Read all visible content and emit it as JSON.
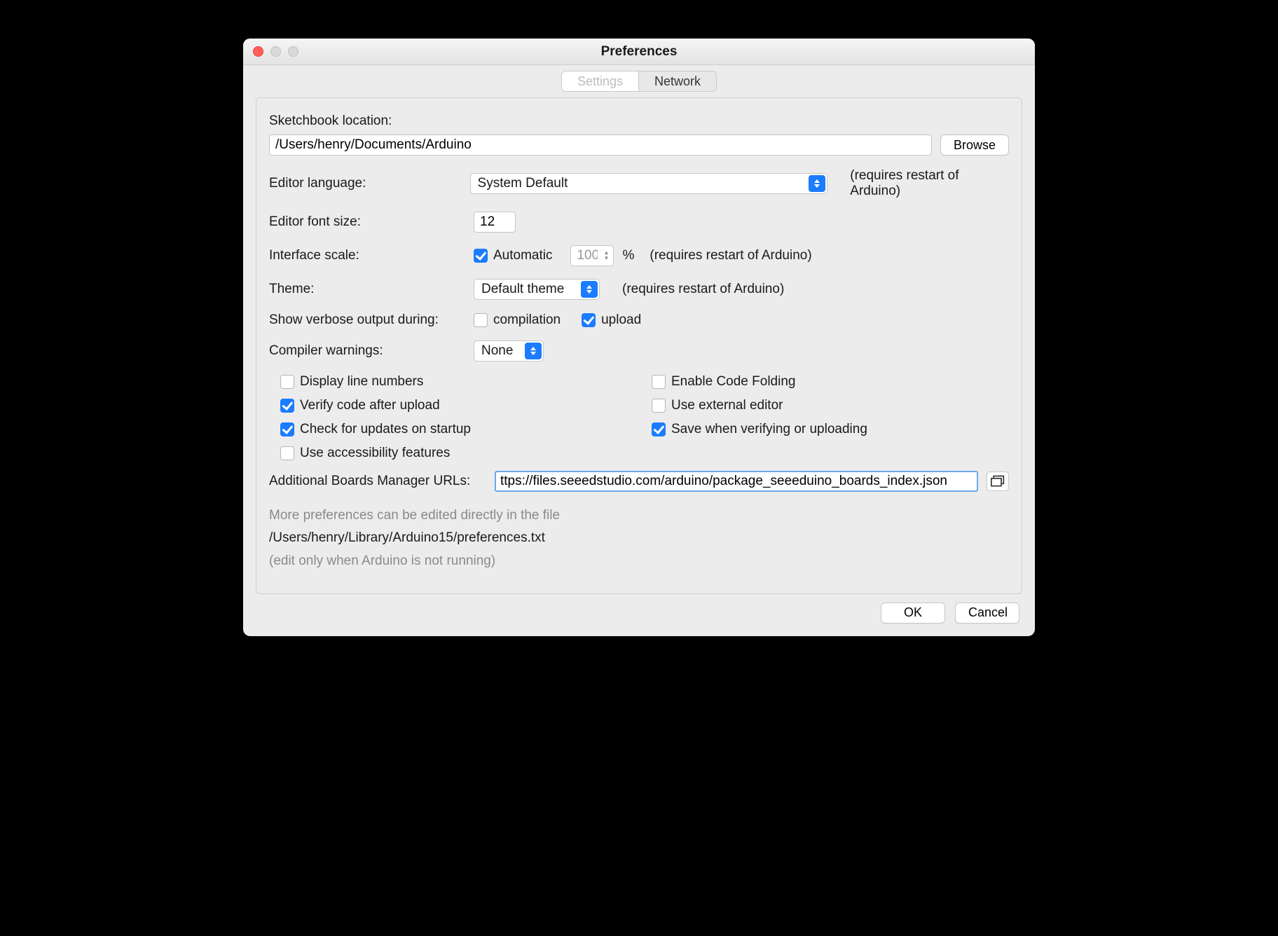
{
  "window": {
    "title": "Preferences"
  },
  "tabs": {
    "settings": "Settings",
    "network": "Network"
  },
  "sketchbook": {
    "label": "Sketchbook location:",
    "value": "/Users/henry/Documents/Arduino",
    "browse": "Browse"
  },
  "editorLanguage": {
    "label": "Editor language:",
    "value": "System Default",
    "hint": "(requires restart of Arduino)"
  },
  "fontSize": {
    "label": "Editor font size:",
    "value": "12"
  },
  "scale": {
    "label": "Interface scale:",
    "autoLabel": "Automatic",
    "autoChecked": true,
    "value": "100",
    "percent": "%",
    "hint": "(requires restart of Arduino)"
  },
  "theme": {
    "label": "Theme:",
    "value": "Default theme",
    "hint": "(requires restart of Arduino)"
  },
  "verbose": {
    "label": "Show verbose output during:",
    "compilationLabel": "compilation",
    "compilationChecked": false,
    "uploadLabel": "upload",
    "uploadChecked": true
  },
  "warnings": {
    "label": "Compiler warnings:",
    "value": "None"
  },
  "options": {
    "lineNumbers": {
      "label": "Display line numbers",
      "checked": false
    },
    "codeFolding": {
      "label": "Enable Code Folding",
      "checked": false
    },
    "verifyUpload": {
      "label": "Verify code after upload",
      "checked": true
    },
    "externalEditor": {
      "label": "Use external editor",
      "checked": false
    },
    "checkUpdates": {
      "label": "Check for updates on startup",
      "checked": true
    },
    "saveOnVerify": {
      "label": "Save when verifying or uploading",
      "checked": true
    },
    "accessibility": {
      "label": "Use accessibility features",
      "checked": false
    }
  },
  "boardsUrls": {
    "label": "Additional Boards Manager URLs:",
    "value": "ttps://files.seeedstudio.com/arduino/package_seeeduino_boards_index.json"
  },
  "footnote": {
    "line1": "More preferences can be edited directly in the file",
    "path": "/Users/henry/Library/Arduino15/preferences.txt",
    "line3": "(edit only when Arduino is not running)"
  },
  "footer": {
    "ok": "OK",
    "cancel": "Cancel"
  }
}
